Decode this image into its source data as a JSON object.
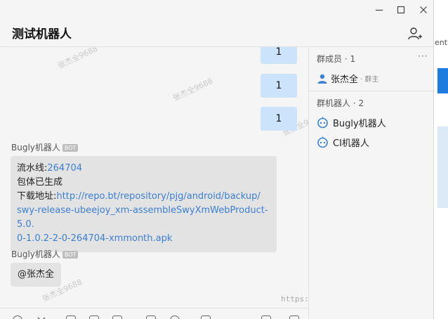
{
  "window": {
    "title": "测试机器人",
    "controls": [
      "minimize-icon",
      "maximize-icon",
      "close-icon"
    ]
  },
  "background_app": {
    "partial_text": "ent"
  },
  "watermark": "张杰全9688",
  "messages": {
    "mine": [
      "1",
      "1",
      "1"
    ],
    "bot1": {
      "sender": "Bugly机器人",
      "badge": "BOT",
      "line1_label": "流水线:",
      "line1_link": "264704",
      "line2": "包体已生成",
      "line3_label": "下载地址:",
      "line3_link_a": "http://repo.bt/repository/pjg/android/backup/",
      "line3_link_b": "swy-release-ubeejoy_xm-assembleSwyXmWebProduct-5.0.",
      "line3_link_c": "0-1.0.2-2-0-264704-xmmonth.apk"
    },
    "bot2": {
      "sender": "Bugly机器人",
      "badge": "BOT",
      "text": "@张杰全"
    }
  },
  "sidebar": {
    "members_header": "群成员 · 1",
    "more": "···",
    "members": [
      {
        "name": "张杰全",
        "role": "· 群主"
      }
    ],
    "robots_header": "群机器人 · 2",
    "robots": [
      {
        "name": "Bugly机器人"
      },
      {
        "name": "CI机器人"
      }
    ]
  },
  "footer_url": "https://github.com/zhangjiequan",
  "colors": {
    "accent": "#3b7fd3",
    "my_bubble": "#cce4fb",
    "bot_bubble": "#e3e3e3"
  }
}
